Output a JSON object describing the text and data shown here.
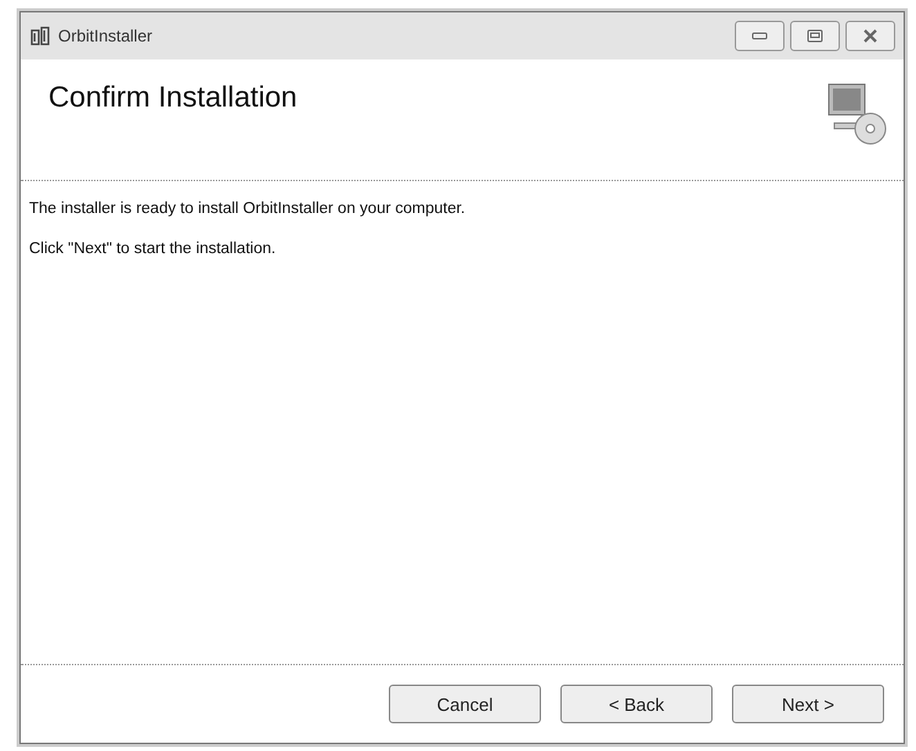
{
  "window": {
    "title": "OrbitInstaller"
  },
  "header": {
    "title": "Confirm Installation"
  },
  "body": {
    "paragraphs": [
      "The installer is ready to install OrbitInstaller on your computer.",
      "Click \"Next\" to start the installation."
    ]
  },
  "buttons": [
    {
      "label": "Cancel"
    },
    {
      "label": "< Back"
    },
    {
      "label": "Next >"
    }
  ]
}
